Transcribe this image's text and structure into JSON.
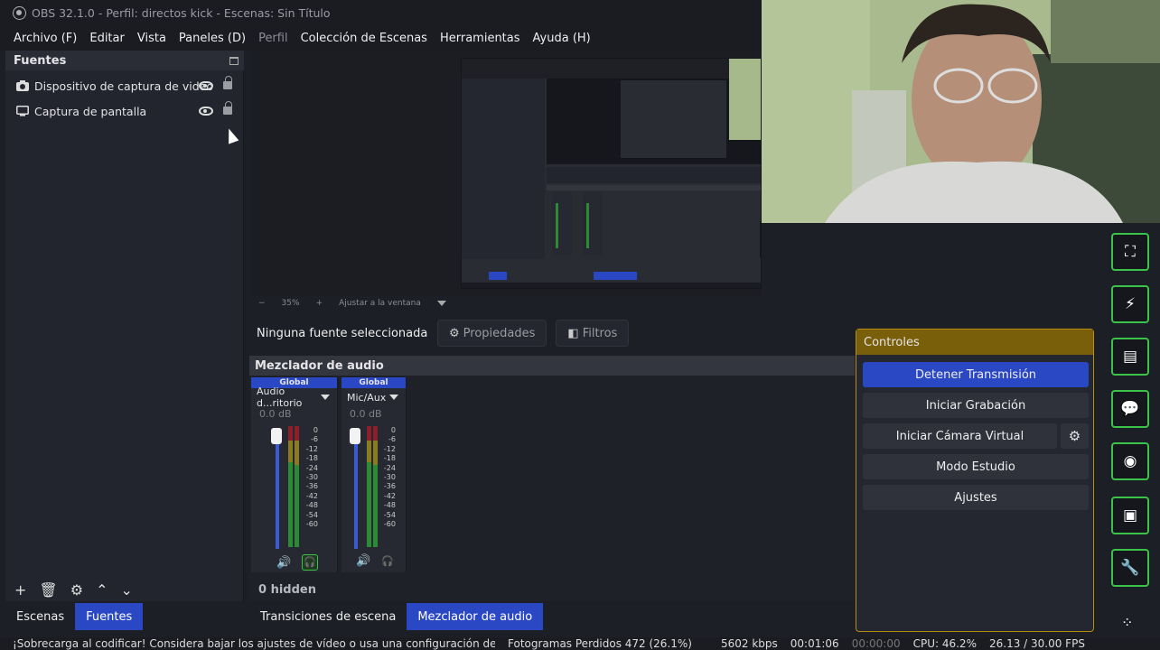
{
  "window": {
    "title": "OBS 32.1.0 - Perfil: directos kick - Escenas: Sin Título"
  },
  "menu": [
    "Archivo (F)",
    "Editar",
    "Vista",
    "Paneles (D)",
    "Perfil",
    "Colección de Escenas",
    "Herramientas",
    "Ayuda (H)"
  ],
  "sources": {
    "title": "Fuentes",
    "items": [
      {
        "label": "Dispositivo de captura de video",
        "icon": "camera-icon"
      },
      {
        "label": "Captura de pantalla",
        "icon": "monitor-icon"
      }
    ],
    "toolbar_icons": [
      "plus-icon",
      "trash-icon",
      "gear-icon",
      "arrow-up-icon",
      "arrow-down-icon"
    ]
  },
  "left_tabs": [
    "Escenas",
    "Fuentes"
  ],
  "preview": {
    "zoom": "35%",
    "fit_label": "Ajustar a la ventana"
  },
  "props_bar": {
    "no_source": "Ninguna fuente seleccionada",
    "properties": "Propiedades",
    "filters": "Filtros"
  },
  "mixer": {
    "title": "Mezclador de audio",
    "channels": [
      {
        "scope": "Global",
        "name": "Audio d...ritorio",
        "db": "0.0 dB"
      },
      {
        "scope": "Global",
        "name": "Mic/Aux",
        "db": "0.0 dB"
      }
    ],
    "ticks": [
      "0",
      "-6",
      "-12",
      "-18",
      "-24",
      "-30",
      "-36",
      "-42",
      "-48",
      "-54",
      "-60"
    ],
    "hidden": "0 hidden"
  },
  "mid_tabs": [
    "Transiciones de escena",
    "Mezclador de audio"
  ],
  "controls": {
    "title": "Controles",
    "buttons": [
      "Detener Transmisión",
      "Iniciar Grabación",
      "Iniciar Cámara Virtual",
      "Modo Estudio",
      "Ajustes"
    ]
  },
  "dock_icons": [
    "screenshot-icon",
    "lightning-icon",
    "notes-icon",
    "chat-icon",
    "broadcast-icon",
    "scene-icon",
    "wrench-icon",
    "menu-dots-icon"
  ],
  "status": {
    "warning": "¡Sobrecarga al codificar! Considera bajar los ajustes de vídeo o usa una configuración del codificador más rápida.",
    "dropped": "Fotogramas Perdidos 472 (26.1%)",
    "bitrate": "5602 kbps",
    "stream_time": "00:01:06",
    "rec_time": "00:00:00",
    "cpu": "CPU: 46.2%",
    "fps": "26.13 / 30.00 FPS"
  },
  "colors": {
    "accent": "#2b48c4",
    "dock_border": "#3bc24a",
    "controls_border": "#b88c0f"
  }
}
